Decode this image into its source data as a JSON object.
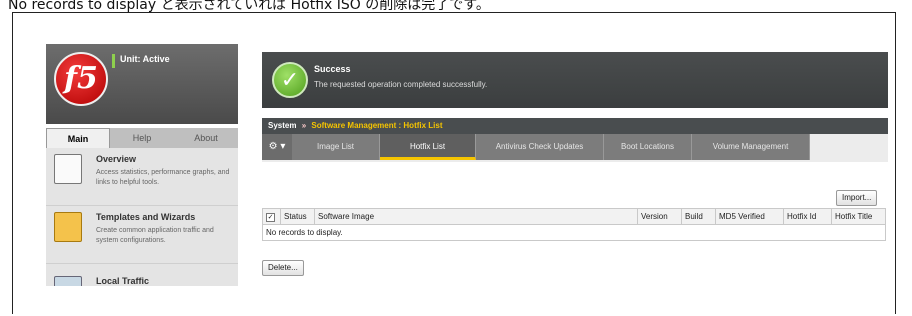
{
  "caption": "No records to display と表示されていれば Hotfix ISO の削除は完了です。",
  "header": {
    "logo_text": "f5",
    "unit_status": "Unit: Active"
  },
  "banner": {
    "title": "Success",
    "message": "The requested operation completed successfully."
  },
  "left_tabs": [
    {
      "label": "Main"
    },
    {
      "label": "Help"
    },
    {
      "label": "About"
    }
  ],
  "nav": [
    {
      "title": "Overview",
      "desc": "Access statistics, performance graphs, and links to helpful tools."
    },
    {
      "title": "Templates and Wizards",
      "desc": "Create common application traffic and system configurations."
    },
    {
      "title": "Local Traffic",
      "desc": ""
    }
  ],
  "breadcrumb": {
    "root": "System",
    "separator": "»",
    "path": "Software Management : Hotfix List"
  },
  "subtabs": [
    {
      "label": "Image List"
    },
    {
      "label": "Hotfix List"
    },
    {
      "label": "Antivirus Check Updates"
    },
    {
      "label": "Boot Locations"
    },
    {
      "label": "Volume Management"
    }
  ],
  "buttons": {
    "import": "Import...",
    "delete": "Delete..."
  },
  "table": {
    "columns": [
      "Status",
      "Software Image",
      "Version",
      "Build",
      "MD5 Verified",
      "Hotfix Id",
      "Hotfix Title"
    ],
    "empty_message": "No records to display."
  },
  "colors": {
    "accent": "#f5c400",
    "success": "#4f9e1b",
    "brand": "#c40000"
  }
}
